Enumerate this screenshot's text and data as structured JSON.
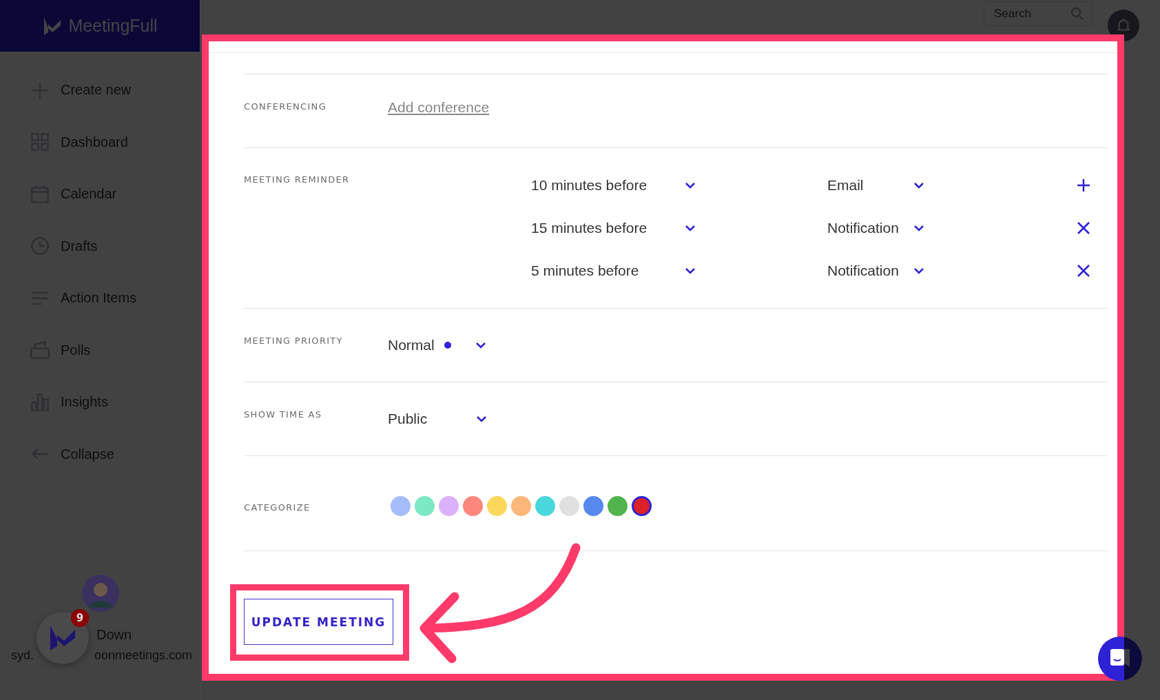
{
  "app": {
    "logo": "MeetingFull"
  },
  "sidebar": {
    "items": [
      {
        "kind": "plus",
        "label": "Create new"
      },
      {
        "kind": "grid",
        "label": "Dashboard"
      },
      {
        "kind": "calendar",
        "label": "Calendar"
      },
      {
        "kind": "clock",
        "label": "Drafts"
      },
      {
        "kind": "lines",
        "label": "Action Items"
      },
      {
        "kind": "ballot",
        "label": "Polls"
      },
      {
        "kind": "bars",
        "label": "Insights"
      },
      {
        "kind": "back",
        "label": "Collapse"
      }
    ]
  },
  "user": {
    "name": "Down",
    "email_start": "syd.",
    "email_end": "oonmeetings.com",
    "notification_count": "9"
  },
  "header": {
    "search": {
      "placeholder": "Search"
    }
  },
  "form": {
    "rows": [
      {
        "kind": "link",
        "label": "CONFERENCING",
        "value": "Add conference"
      },
      {
        "kind": "reminders",
        "label": "MEETING REMINDER",
        "reminders": [
          {
            "time": "10 minutes before",
            "method": "Email",
            "kind": "add"
          },
          {
            "time": "15 minutes before",
            "method": "Notification",
            "kind": "remove"
          },
          {
            "time": "5 minutes before",
            "method": "Notification",
            "kind": "remove"
          }
        ]
      },
      {
        "kind": "select",
        "label": "MEETING PRIORITY",
        "value": "Normal",
        "color": "#2d22d6"
      },
      {
        "kind": "select",
        "label": "SHOW TIME AS",
        "value": "Public"
      },
      {
        "kind": "colors",
        "label": "CATEGORIZE",
        "colors": [
          {
            "color": "#a6bdfc",
            "selected": false
          },
          {
            "color": "#7de8c4",
            "selected": false
          },
          {
            "color": "#dcb1fc",
            "selected": false
          },
          {
            "color": "#fe877b",
            "selected": false
          },
          {
            "color": "#fbd75c",
            "selected": false
          },
          {
            "color": "#feb77b",
            "selected": false
          },
          {
            "color": "#4ad8de",
            "selected": false
          },
          {
            "color": "#e0e0e0",
            "selected": false
          },
          {
            "color": "#5688ee",
            "selected": false
          },
          {
            "color": "#52b44c",
            "selected": false
          },
          {
            "color": "#dc2128",
            "selected": true
          }
        ]
      }
    ],
    "button": "UPDATE MEETING"
  }
}
